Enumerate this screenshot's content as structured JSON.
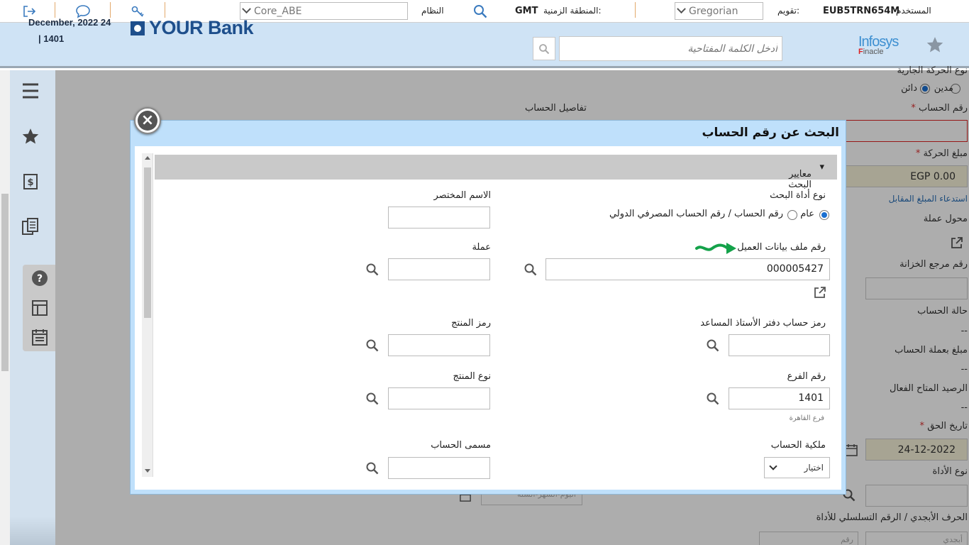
{
  "topbar": {
    "user_label": "المستخدم",
    "user_id": "EUB5TRN654M",
    "calendar_label": "تقويم:",
    "calendar_value": "Gregorian",
    "timezone_label": "المنطقة الزمنية:",
    "timezone_value": "GMT",
    "system_label": "النظام",
    "system_value": "Core_ABE"
  },
  "header": {
    "date": "December, 2022 24",
    "branch": "| 1401",
    "bank_name": "YOUR Bank",
    "search_placeholder": "أدخل الكلمة المفتاحية",
    "vendor_logo_top": "Infosys",
    "vendor_logo_sub_f": "F",
    "vendor_logo_sub": "inacle"
  },
  "background_form": {
    "txn_type": "نوع الحركة الجارية",
    "debit": "مدين",
    "credit": "دائن",
    "account_number": "رقم الحساب",
    "account_details": "تفاصيل الحساب",
    "amount": "مبلغ الحركة",
    "amount_value": "EGP 0.00",
    "fetch_amount": "استدعاء المبلغ المقابل",
    "currency_converter": "محول عملة",
    "treasury_ref": "رقم مرجع الخزانة",
    "account_status": "حالة الحساب",
    "account_status_value": "--",
    "amount_in_acct_ccy": "مبلغ بعملة الحساب",
    "amount_in_acct_ccy_value": "--",
    "available_balance": "الرصيد المتاح الفعال",
    "available_balance_value": "--",
    "value_date": "تاريخ الحق",
    "value_date_value": "24-12-2022",
    "instrument_type": "نوع الأداة",
    "instrument_alpha": "الحرف الأبجدي / الرقم التسلسلي للأداة",
    "alpha_placeholder": "أبجدي",
    "number_placeholder": "رقم",
    "date_placeholder": "اليوم-الشهر-السنة"
  },
  "modal": {
    "title": "البحث عن رقم الحساب",
    "section_title": "معايير البحث",
    "search_type_label": "نوع أداة البحث",
    "radio_general": "عام",
    "radio_account": "رقم الحساب / رقم الحساب المصرفي الدولي",
    "short_name_label": "الاسم المختصر",
    "cif_label": "رقم ملف بيانات العميل",
    "cif_value": "000005427",
    "currency_label": "عملة",
    "gl_code_label": "رمز حساب دفتر الأستاذ المساعد",
    "product_code_label": "رمز المنتج",
    "branch_label": "رقم الفرع",
    "branch_value": "1401",
    "branch_name": "فرع القاهرة",
    "product_type_label": "نوع المنتج",
    "ownership_label": "ملكية الحساب",
    "ownership_value": "اختيار",
    "account_title_label": "مسمى الحساب"
  }
}
